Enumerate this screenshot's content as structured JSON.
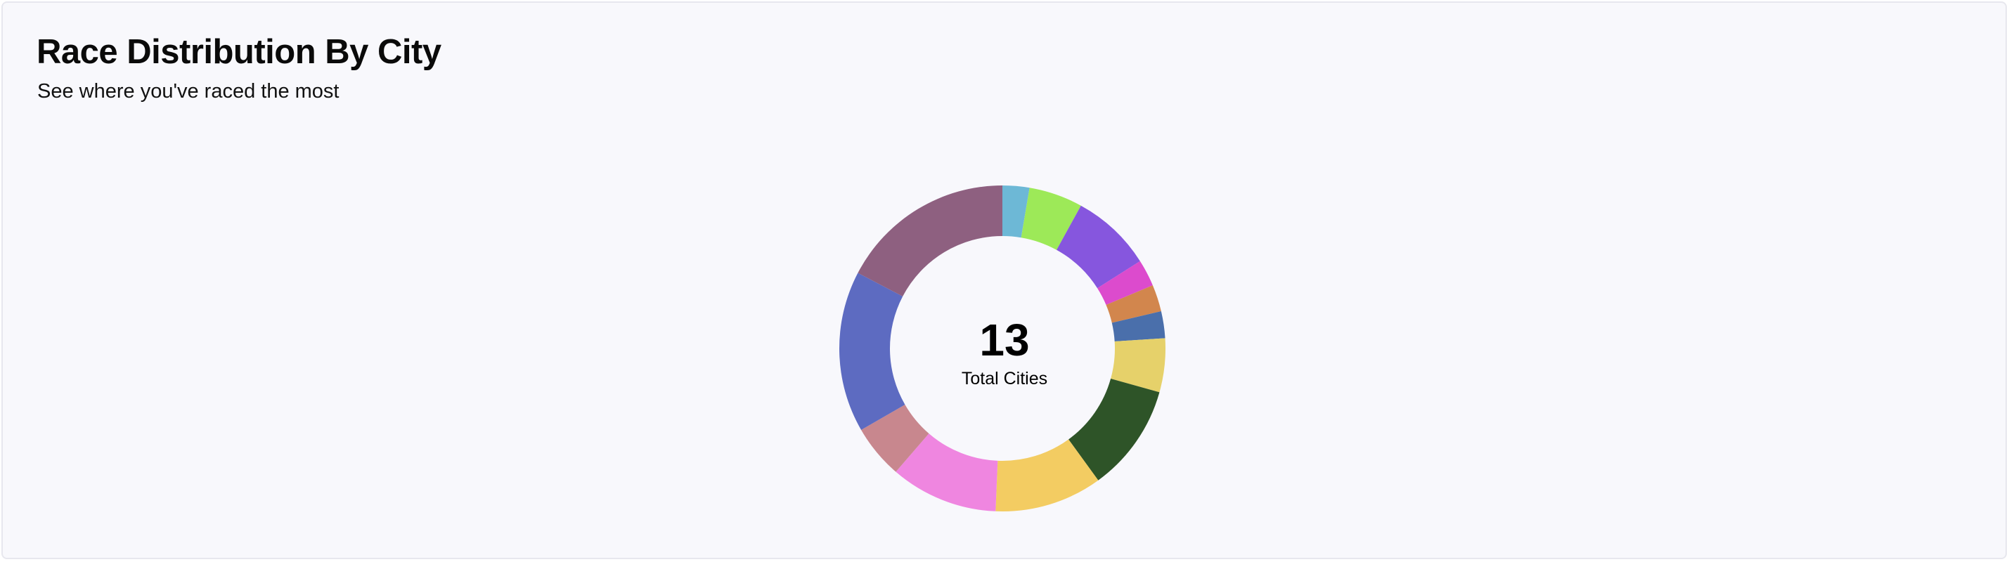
{
  "header": {
    "title": "Race Distribution By City",
    "subtitle": "See where you've raced the most"
  },
  "center": {
    "value": "13",
    "label": "Total Cities"
  },
  "chart_data": {
    "type": "pie",
    "donut": true,
    "title": "Race Distribution By City",
    "subtitle": "See where you've raced the most",
    "start_angle_deg": 0,
    "slices": [
      {
        "value": 1.0,
        "color": "#6db8d6"
      },
      {
        "value": 2.0,
        "color": "#9de958"
      },
      {
        "value": 3.0,
        "color": "#8656de"
      },
      {
        "value": 1.0,
        "color": "#dc4bcd"
      },
      {
        "value": 1.0,
        "color": "#d2864d"
      },
      {
        "value": 1.0,
        "color": "#4a6fab"
      },
      {
        "value": 2.0,
        "color": "#e6d16a"
      },
      {
        "value": 4.0,
        "color": "#2e5428"
      },
      {
        "value": 4.0,
        "color": "#f3cc62"
      },
      {
        "value": 4.0,
        "color": "#ef86e0"
      },
      {
        "value": 2.0,
        "color": "#c8878e"
      },
      {
        "value": 6.0,
        "color": "#5d6bc1"
      },
      {
        "value": 6.5,
        "color": "#8e6080"
      }
    ]
  }
}
